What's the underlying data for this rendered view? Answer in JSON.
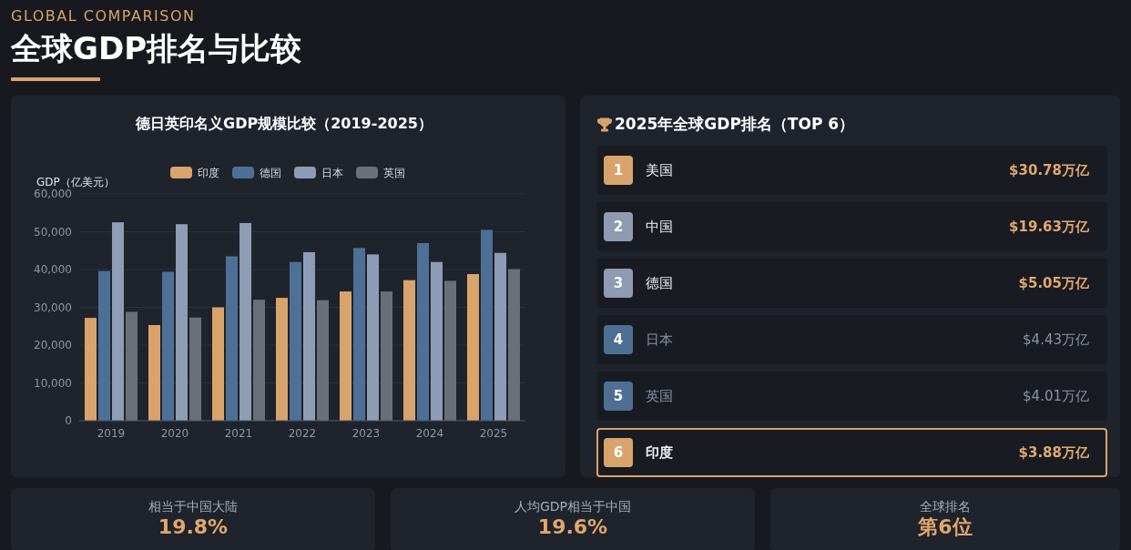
{
  "header": {
    "eyebrow": "GLOBAL COMPARISON",
    "title": "全球GDP排名与比较"
  },
  "chart_panel": {
    "chart_data": {
      "type": "bar",
      "title": "德日英印名义GDP规模比较（2019-2025）",
      "ylabel": "GDP（亿美元）",
      "categories": [
        "2019",
        "2020",
        "2021",
        "2022",
        "2023",
        "2024",
        "2025"
      ],
      "series": [
        {
          "name": "印度",
          "color": "#d9a46c",
          "values": [
            27200,
            25300,
            30000,
            32500,
            34200,
            37200,
            38800
          ]
        },
        {
          "name": "德国",
          "color": "#4e7096",
          "values": [
            39600,
            39400,
            43500,
            42000,
            45700,
            47000,
            50500
          ]
        },
        {
          "name": "日本",
          "color": "#8e9db5",
          "values": [
            52500,
            52000,
            52300,
            44600,
            44000,
            42000,
            44400
          ]
        },
        {
          "name": "英国",
          "color": "#6b6f7a",
          "values": [
            28800,
            27300,
            32000,
            31900,
            34200,
            37000,
            40100
          ]
        }
      ],
      "ylim": [
        0,
        60000
      ],
      "grid": true,
      "legend": true,
      "yticks": [
        {
          "value": 0,
          "label": "0"
        },
        {
          "value": 10000,
          "label": "10,000"
        },
        {
          "value": 20000,
          "label": "20,000"
        },
        {
          "value": 30000,
          "label": "30,000"
        },
        {
          "value": 40000,
          "label": "40,000"
        },
        {
          "value": 50000,
          "label": "50,000"
        },
        {
          "value": 60000,
          "label": "60,000"
        }
      ]
    }
  },
  "ranking": {
    "title": "2025年全球GDP排名（TOP 6）",
    "rows": [
      {
        "rank": "1",
        "country": "美国",
        "gdp": "$30.78万亿",
        "color": "#d9a46c",
        "emphasis": true,
        "selected": false
      },
      {
        "rank": "2",
        "country": "中国",
        "gdp": "$19.63万亿",
        "color": "#8e9bb0",
        "emphasis": true,
        "selected": false
      },
      {
        "rank": "3",
        "country": "德国",
        "gdp": "$5.05万亿",
        "color": "#8e9bb0",
        "emphasis": true,
        "selected": false
      },
      {
        "rank": "4",
        "country": "日本",
        "gdp": "$4.43万亿",
        "color": "#4e6f94",
        "emphasis": false,
        "selected": false
      },
      {
        "rank": "5",
        "country": "英国",
        "gdp": "$4.01万亿",
        "color": "#4e6f94",
        "emphasis": false,
        "selected": false
      },
      {
        "rank": "6",
        "country": "印度",
        "gdp": "$3.88万亿",
        "color": "#d9a46c",
        "emphasis": true,
        "selected": true
      }
    ]
  },
  "stats": [
    {
      "label": "相当于中国大陆",
      "value": "19.8%"
    },
    {
      "label": "人均GDP相当于中国",
      "value": "19.6%"
    },
    {
      "label": "全球排名",
      "value": "第6位"
    }
  ]
}
